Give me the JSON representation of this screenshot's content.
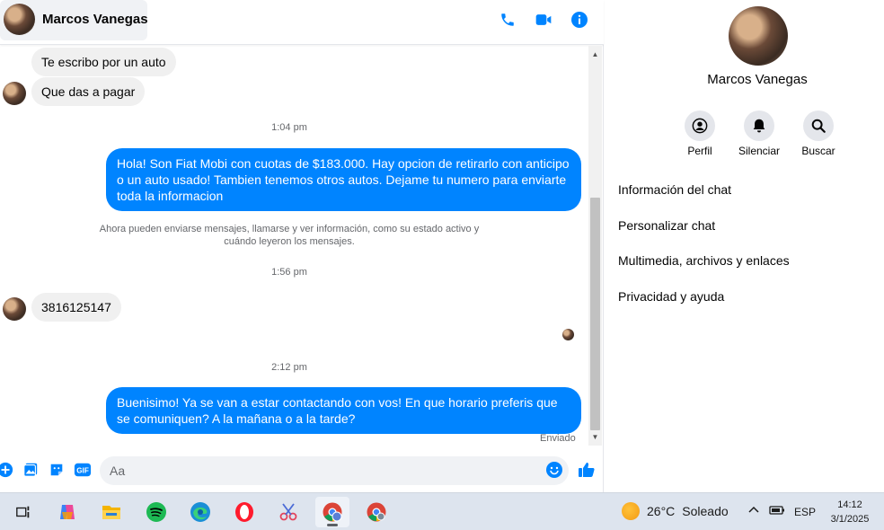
{
  "colors": {
    "messenger_blue": "#0084ff",
    "incoming_bubble": "#f0f0f0",
    "muted_text": "#65676b"
  },
  "header": {
    "contact_name": "Marcos Vanegas",
    "icons": [
      "phone-icon",
      "video-call-icon",
      "info-icon"
    ]
  },
  "messages": {
    "incoming_1": "Te escribo por un auto",
    "incoming_2": "Que das a pagar",
    "time_1": "1:04 pm",
    "outgoing_1": "Hola! Son Fiat Mobi con cuotas de $183.000. Hay opcion de retirarlo con anticipo o un auto usado! Tambien tenemos otros autos. Dejame tu numero para enviarte toda la informacion",
    "system_note": "Ahora pueden enviarse mensajes, llamarse y ver información, como su estado activo y cuándo leyeron los mensajes.",
    "time_2": "1:56 pm",
    "incoming_3": "3816125147",
    "time_3": "2:12 pm",
    "outgoing_2": "Buenisimo! Ya se van a estar contactando con vos! En que horario preferis que se comuniquen? A la mañana o a la tarde?",
    "status": "Enviado"
  },
  "composer": {
    "placeholder": "Aa",
    "icons": [
      "plus-icon",
      "photo-icon",
      "sticker-icon",
      "gif-icon",
      "emoji-icon",
      "like-icon"
    ],
    "gif_label": "GIF"
  },
  "details": {
    "name": "Marcos Vanegas",
    "actions": [
      {
        "label": "Perfil",
        "icon": "profile-icon"
      },
      {
        "label": "Silenciar",
        "icon": "bell-icon"
      },
      {
        "label": "Buscar",
        "icon": "search-icon"
      }
    ],
    "menu": [
      "Información del chat",
      "Personalizar chat",
      "Multimedia, archivos y enlaces",
      "Privacidad y ayuda"
    ]
  },
  "taskbar": {
    "apps": [
      "task-view-icon",
      "copilot-icon",
      "file-explorer-icon",
      "spotify-icon",
      "edge-icon",
      "opera-icon",
      "snipping-tool-icon",
      "chrome-profile-icon",
      "chrome-icon"
    ],
    "weather_temp": "26°C",
    "weather_text": "Soleado",
    "language": "ESP",
    "time": "14:12",
    "date": "3/1/2025"
  }
}
